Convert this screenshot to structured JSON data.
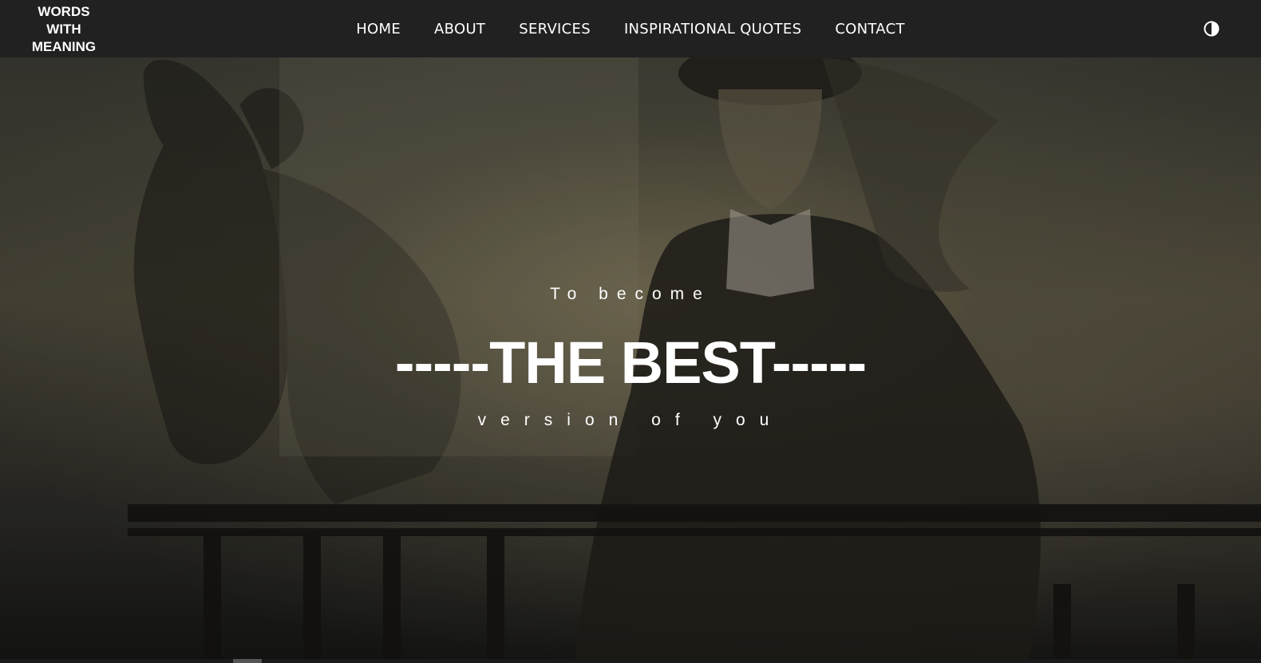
{
  "logo": {
    "line1": "WORDS",
    "line2": "WITH",
    "line3": "MEANING"
  },
  "nav": {
    "items": [
      {
        "label": "HOME"
      },
      {
        "label": "ABOUT"
      },
      {
        "label": "SERVICES"
      },
      {
        "label": "INSPIRATIONAL QUOTES"
      },
      {
        "label": "CONTACT"
      }
    ]
  },
  "theme_toggle": {
    "icon": "contrast-icon"
  },
  "hero": {
    "pre_title": "To become",
    "title": "-----THE BEST-----",
    "sub_title": "version of you"
  },
  "colors": {
    "navbar_bg": "#212121",
    "text": "#ffffff"
  }
}
